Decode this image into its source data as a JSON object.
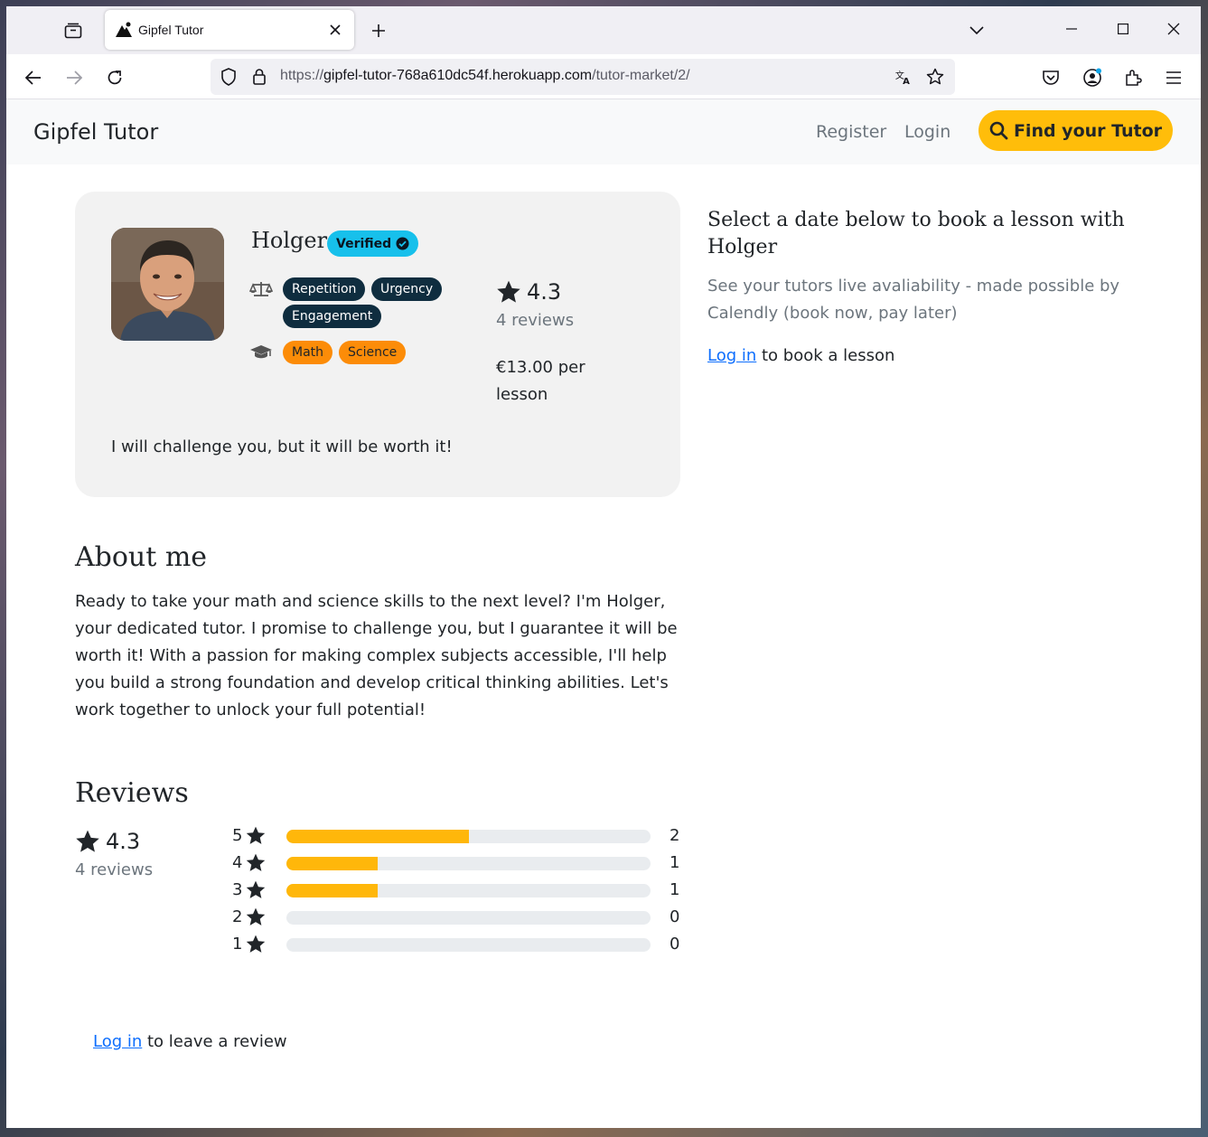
{
  "browser": {
    "tab_title": "Gipfel Tutor",
    "url_scheme": "https://",
    "url_host": "gipfel-tutor-768a610dc54f.herokuapp.com",
    "url_path": "/tutor-market/2/"
  },
  "header": {
    "brand": "Gipfel Tutor",
    "register": "Register",
    "login": "Login",
    "find_button": "Find your Tutor"
  },
  "tutor": {
    "name": "Holger",
    "verified": "Verified",
    "styles": [
      "Repetition",
      "Urgency",
      "Engagement"
    ],
    "subjects": [
      "Math",
      "Science"
    ],
    "rating": "4.3",
    "reviews": "4 reviews",
    "price": "€13.00 per lesson",
    "tagline": "I will challenge you, but it will be worth it!"
  },
  "booking": {
    "title": "Select a date below to book a lesson with Holger",
    "subtitle": "See your tutors live avaliability - made possible by Calendly (book now, pay later)",
    "login_link": "Log in",
    "login_rest": " to book a lesson"
  },
  "about": {
    "title": "About me",
    "text": "Ready to take your math and science skills to the next level? I'm Holger, your dedicated tutor. I promise to challenge you, but I guarantee it will be worth it! With a passion for making complex subjects accessible, I'll help you build a strong foundation and develop critical thinking abilities. Let's work together to unlock your full potential!"
  },
  "reviews_section": {
    "title": "Reviews",
    "rating": "4.3",
    "count": "4 reviews",
    "bars": [
      {
        "stars": "5",
        "count": "2",
        "fraction": 0.5
      },
      {
        "stars": "4",
        "count": "1",
        "fraction": 0.25
      },
      {
        "stars": "3",
        "count": "1",
        "fraction": 0.25
      },
      {
        "stars": "2",
        "count": "0",
        "fraction": 0
      },
      {
        "stars": "1",
        "count": "0",
        "fraction": 0
      }
    ],
    "login_link": "Log in",
    "login_rest": " to leave a review"
  },
  "colors": {
    "accent": "#ffbd0a",
    "verified": "#17c0eb",
    "pill_dark": "#0f2d3f",
    "pill_orange": "#fc8c08",
    "link": "#0d6efd"
  },
  "icons": {
    "styles_row": "balance-scale-icon",
    "subjects_row": "graduation-cap-icon",
    "rating": "star-icon",
    "find": "search-icon"
  }
}
